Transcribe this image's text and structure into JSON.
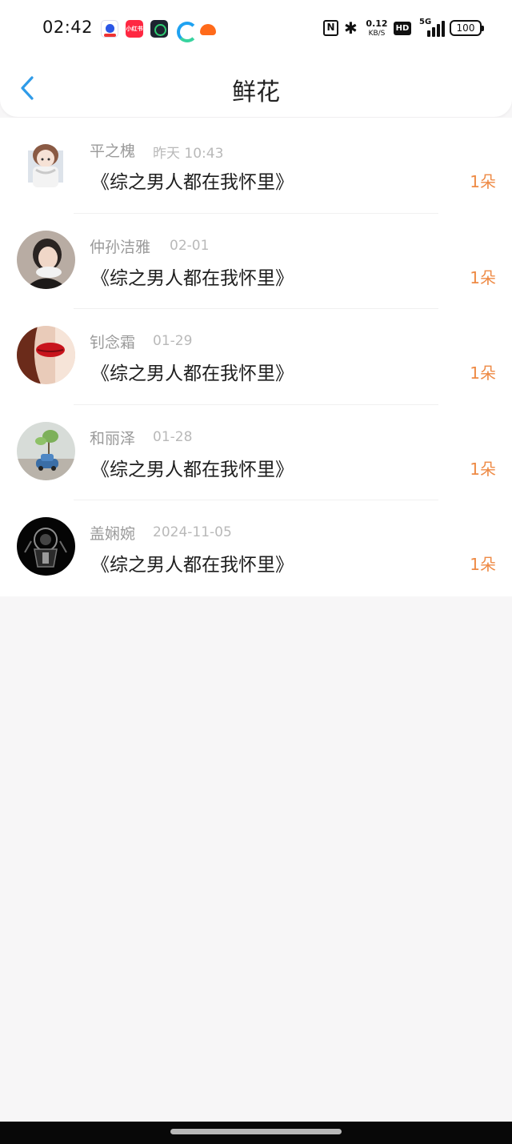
{
  "status_bar": {
    "time": "02:42",
    "xhs_label": "小红书",
    "net_speed_value": "0.12",
    "net_speed_unit": "KB/S",
    "hd": "HD",
    "network": "5G",
    "battery": "100"
  },
  "header": {
    "title": "鲜花"
  },
  "flowers": [
    {
      "name": "平之槐",
      "date": "昨天 10:43",
      "book": "《综之男人都在我怀里》",
      "count": "1朵"
    },
    {
      "name": "仲孙洁雅",
      "date": "02-01",
      "book": "《综之男人都在我怀里》",
      "count": "1朵"
    },
    {
      "name": "钊念霜",
      "date": "01-29",
      "book": "《综之男人都在我怀里》",
      "count": "1朵"
    },
    {
      "name": "和丽泽",
      "date": "01-28",
      "book": "《综之男人都在我怀里》",
      "count": "1朵"
    },
    {
      "name": "盖娴婉",
      "date": "2024-11-05",
      "book": "《综之男人都在我怀里》",
      "count": "1朵"
    }
  ],
  "colors": {
    "accent_blue": "#2f9be8",
    "count_orange": "#ee8a45",
    "name_gray": "#9a9a9a",
    "background": "#f7f6f7"
  }
}
